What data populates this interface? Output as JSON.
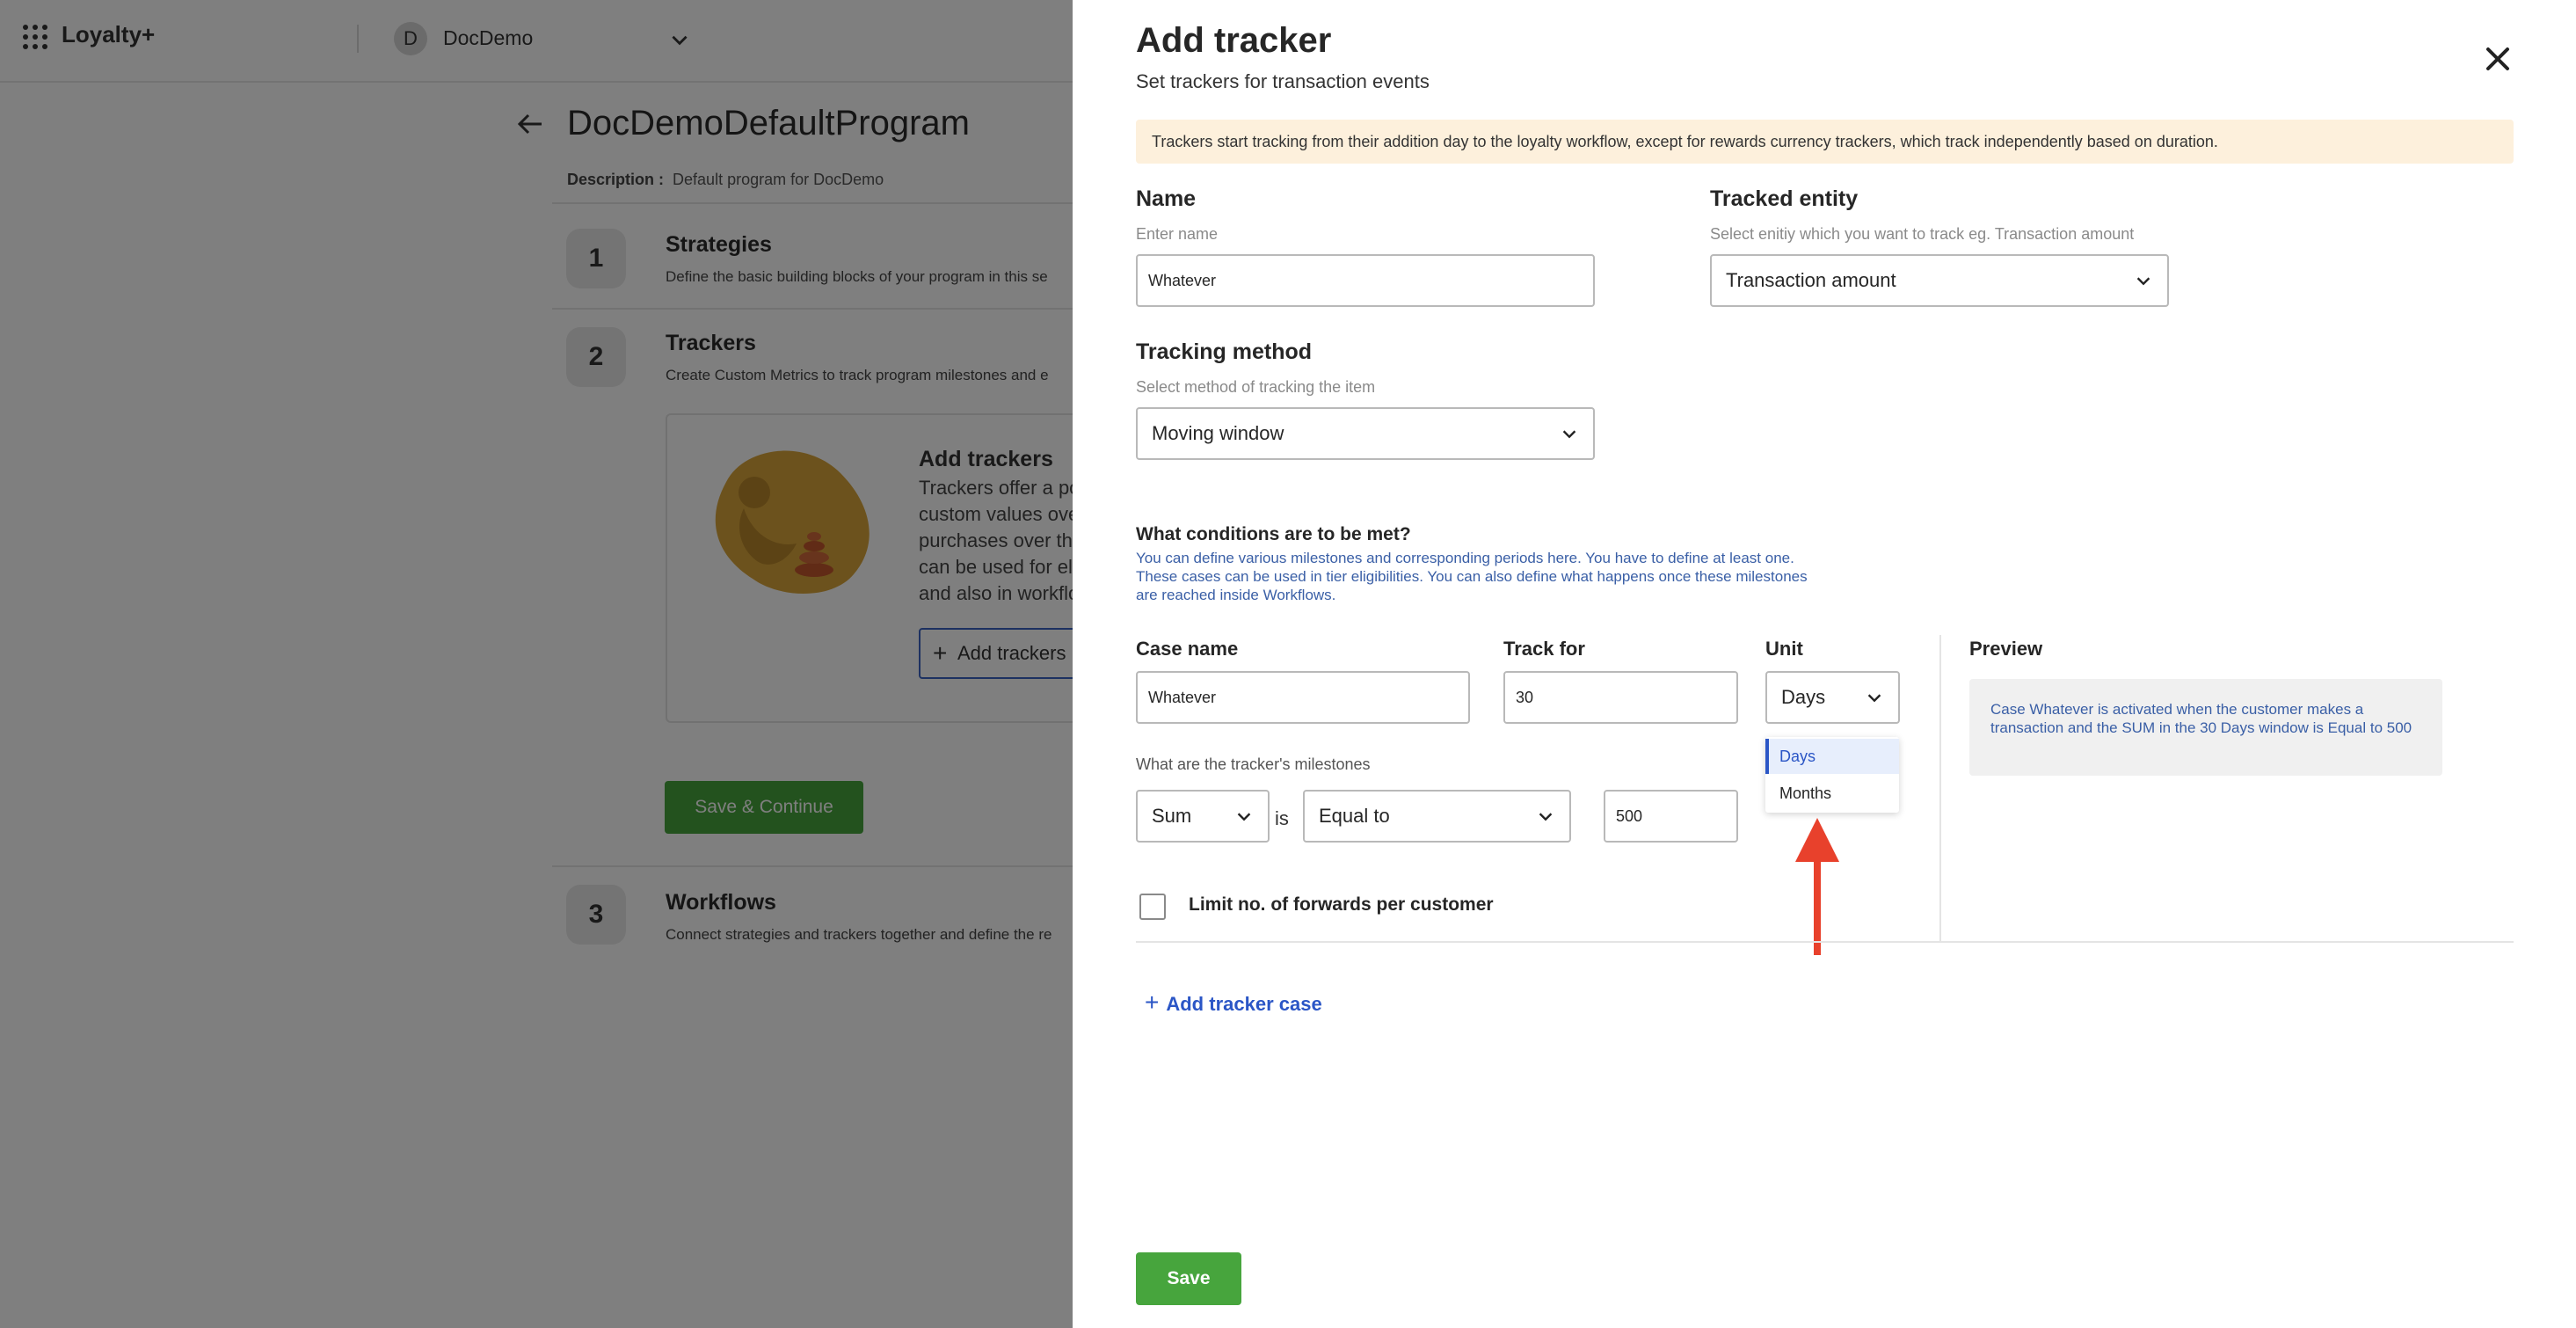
{
  "header": {
    "app_name": "Loyalty+",
    "org_initial": "D",
    "org_name": "DocDemo"
  },
  "program": {
    "title": "DocDemoDefaultProgram",
    "description_label": "Description :",
    "description_value": "Default program for DocDemo"
  },
  "steps": [
    {
      "number": "1",
      "title": "Strategies",
      "subtitle": "Define the basic building blocks of your program in this se"
    },
    {
      "number": "2",
      "title": "Trackers",
      "subtitle": "Create Custom Metrics to track program milestones and e"
    },
    {
      "number": "3",
      "title": "Workflows",
      "subtitle": "Connect strategies and trackers together and define the re"
    }
  ],
  "tracker_card": {
    "title": "Add trackers",
    "body_lines": [
      "Trackers offer a po",
      "custom values ove",
      "purchases over the",
      "can be used for eli",
      "and also in workflo"
    ],
    "button_label": "Add trackers"
  },
  "save_continue_label": "Save & Continue",
  "drawer": {
    "title": "Add tracker",
    "subtitle": "Set trackers for transaction events",
    "banner": "Trackers start tracking from their addition day to the loyalty workflow, except for rewards currency trackers, which track independently based on duration.",
    "name": {
      "label": "Name",
      "hint": "Enter name",
      "value": "Whatever"
    },
    "tracked_entity": {
      "label": "Tracked entity",
      "hint": "Select enitiy which you want to track eg. Transaction amount",
      "value": "Transaction amount"
    },
    "tracking_method": {
      "label": "Tracking method",
      "hint": "Select method of tracking the item",
      "value": "Moving window"
    },
    "conditions": {
      "title": "What conditions are to be met?",
      "body": "You can define various milestones and corresponding periods here. You have to define at least one. These cases can be used in tier eligibilities. You can also define what happens once these milestones are reached inside Workflows."
    },
    "case": {
      "case_name_label": "Case name",
      "case_name_value": "Whatever",
      "track_for_label": "Track for",
      "track_for_value": "30",
      "unit_label": "Unit",
      "unit_value": "Days",
      "unit_options": [
        "Days",
        "Months"
      ],
      "preview_label": "Preview",
      "preview_text": "Case Whatever is activated when the customer makes a transaction and the SUM in the 30 Days window is Equal to 500",
      "milestones_label": "What are the tracker's milestones",
      "aggregate_value": "Sum",
      "is_label": "is",
      "operator_value": "Equal to",
      "threshold_value": "500",
      "limit_label": "Limit no. of forwards per customer",
      "limit_checked": false
    },
    "add_case_label": "Add tracker case",
    "save_label": "Save"
  },
  "colors": {
    "primary_green": "#47a53d",
    "link_blue": "#2b56c6",
    "banner_bg": "#fdf0dc",
    "annotation_arrow": "#e8412c"
  }
}
